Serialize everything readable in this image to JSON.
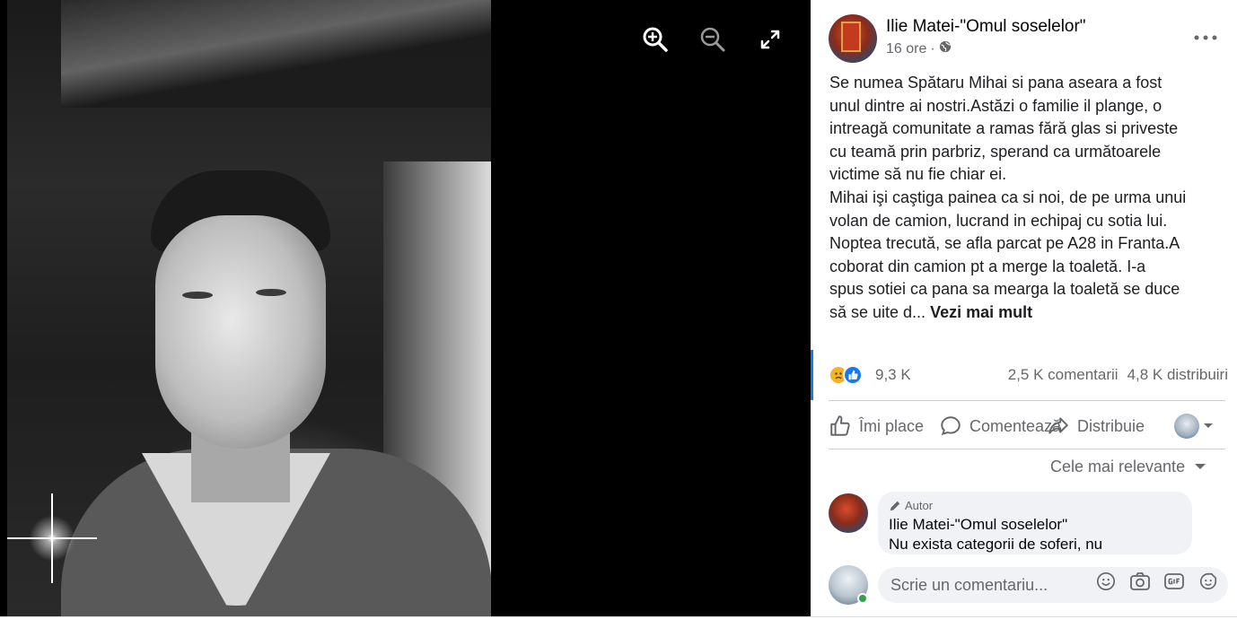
{
  "viewer": {
    "tools": [
      {
        "name": "zoom-in-icon"
      },
      {
        "name": "zoom-out-icon"
      },
      {
        "name": "fullscreen-icon"
      }
    ]
  },
  "post": {
    "author": "Ilie Matei-\"Omul soselelor\"",
    "time": "16 ore",
    "separator": "·",
    "text_lines": [
      "Se numea Spătaru Mihai si pana aseara a fost",
      "unul dintre ai nostri.Astăzi o familie il plange, o",
      "intreagă comunitate a ramas fără glas si priveste",
      "cu teamă prin parbriz, sperand ca următoarele",
      "victime să nu fie chiar ei.",
      "Mihai işi caştiga painea ca si noi, de pe urma unui",
      "volan de camion, lucrand in echipaj cu sotia lui.",
      "Noptea trecută, se afla parcat pe A28 in Franta.A",
      "coborat din camion pt a merge la toaletă. I-a",
      "spus sotiei ca pana sa mearga la toaletă se duce"
    ],
    "last_line": "să se uite d...",
    "see_more": "Vezi mai mult"
  },
  "stats": {
    "reactions": "9,3 K",
    "comments": "2,5 K comentarii",
    "shares": "4,8 K distribuiri"
  },
  "actions": {
    "like": "Îmi place",
    "comment": "Comentează",
    "share": "Distribuie"
  },
  "relevance": "Cele mai relevante",
  "comment": {
    "badge": "Autor",
    "author": "Ilie Matei-\"Omul soselelor\"",
    "text": "Nu exista categorii de soferi, nu"
  },
  "composer": {
    "placeholder": "Scrie un comentariu..."
  },
  "colors": {
    "accent": "#1877f2",
    "secondary_text": "#65676b",
    "online": "#31a24c"
  }
}
